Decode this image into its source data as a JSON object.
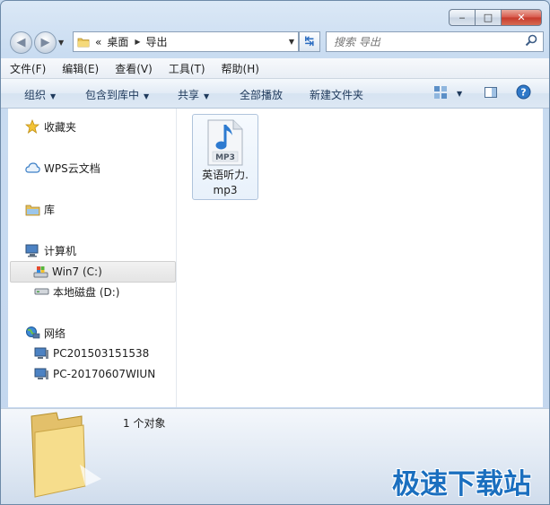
{
  "window": {
    "minimize": "‒",
    "maximize": "□",
    "close": "✕"
  },
  "address": {
    "prefix": "«",
    "crumbs": [
      "桌面",
      "导出"
    ]
  },
  "search": {
    "placeholder": "搜索 导出"
  },
  "menu": [
    "文件(F)",
    "编辑(E)",
    "查看(V)",
    "工具(T)",
    "帮助(H)"
  ],
  "toolbar": {
    "organize": "组织",
    "include_library": "包含到库中",
    "share": "共享",
    "play_all": "全部播放",
    "new_folder": "新建文件夹"
  },
  "nav": {
    "favorites": "收藏夹",
    "wps": "WPS云文档",
    "libraries": "库",
    "computer": "计算机",
    "drive_c": "Win7 (C:)",
    "drive_d": "本地磁盘 (D:)",
    "network": "网络",
    "pc1": "PC201503151538",
    "pc2": "PC-20170607WIUN"
  },
  "files": [
    {
      "name_line1": "英语听力.",
      "name_line2": "mp3",
      "badge": "MP3"
    }
  ],
  "details": {
    "count": "1 个对象"
  },
  "watermark": "极速下载站",
  "icons": {
    "back": "back-arrow-icon",
    "forward": "forward-arrow-icon",
    "search": "magnifier-icon",
    "view": "view-options-icon",
    "preview": "preview-pane-icon",
    "help": "help-icon"
  }
}
